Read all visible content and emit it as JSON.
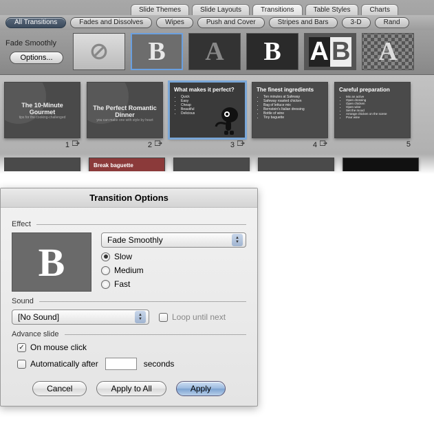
{
  "topTabs": {
    "slideThemes": "Slide Themes",
    "slideLayouts": "Slide Layouts",
    "transitions": "Transitions",
    "tableStyles": "Table Styles",
    "charts": "Charts"
  },
  "categories": {
    "all": "All Transitions",
    "fades": "Fades and Dissolves",
    "wipes": "Wipes",
    "push": "Push and Cover",
    "stripes": "Stripes and Bars",
    "threeD": "3-D",
    "random": "Rand"
  },
  "gallery": {
    "currentLabel": "Fade Smoothly",
    "optionsBtn": "Options..."
  },
  "slides": {
    "s1": {
      "title": "The 10-Minute Gourmet",
      "sub": "tips for the cooking-challenged",
      "num": "1"
    },
    "s2": {
      "title": "The Perfect Romantic Dinner",
      "sub": "you can make one with style by heart",
      "num": "2"
    },
    "s3": {
      "title": "What makes it perfect?",
      "b1": "Quick",
      "b2": "Easy",
      "b3": "Cheap",
      "b4": "Beautiful",
      "b5": "Delicious",
      "num": "3"
    },
    "s4": {
      "title": "The finest ingredients",
      "b1": "Ten minutes at Safeway",
      "b2": "Safeway roasted chicken",
      "b3": "Bag of lettuce mix",
      "b4": "Bernstein's Italian dressing",
      "b5": "Bottle of wine",
      "b6": "Tiny baguette",
      "num": "4"
    },
    "s5": {
      "title": "Careful preparation",
      "b1": "Mix an active",
      "b2": "Open dressing",
      "b3": "Open chicken",
      "b4": "Open wine",
      "b5": "Set the mood",
      "b6": "Arrange chicken on the scene",
      "b7": "Pour wine",
      "num": "5"
    }
  },
  "dialog": {
    "title": "Transition Options",
    "effectSection": "Effect",
    "effectPopup": "Fade Smoothly",
    "speedSlow": "Slow",
    "speedMedium": "Medium",
    "speedFast": "Fast",
    "soundSection": "Sound",
    "soundPopup": "[No Sound]",
    "loopLabel": "Loop until next",
    "advanceSection": "Advance slide",
    "onMouseLabel": "On mouse click",
    "autoAfterLabel": "Automatically after",
    "secondsLabel": "seconds",
    "secondsValue": "",
    "cancel": "Cancel",
    "applyAll": "Apply to All",
    "apply": "Apply"
  }
}
